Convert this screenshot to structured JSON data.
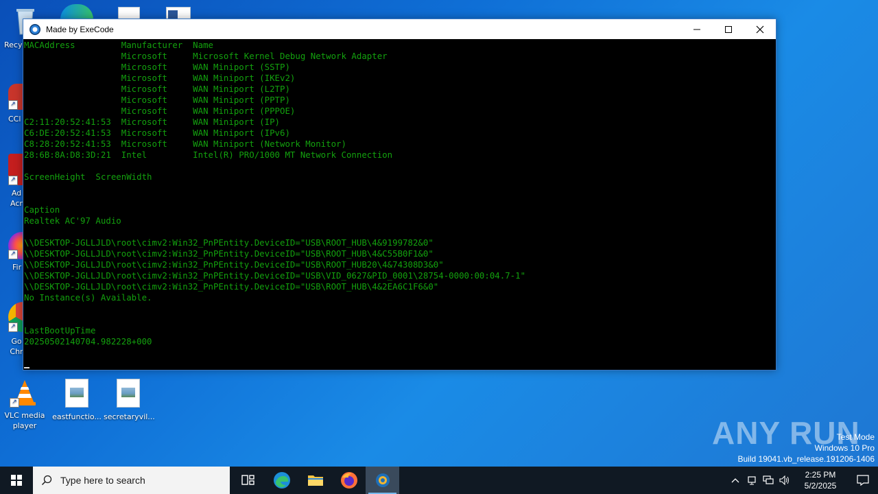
{
  "desktop": {
    "partial_icons": [
      {
        "label": "Recy"
      },
      {
        "label": "CCl"
      },
      {
        "label": "Ad Acr"
      },
      {
        "label": "Fir"
      },
      {
        "label": "Go Chr"
      }
    ],
    "icons": [
      {
        "label": "VLC media player"
      },
      {
        "label": "eastfunctio..."
      },
      {
        "label": "secretaryvil..."
      }
    ]
  },
  "window": {
    "title": "Made by ExeCode",
    "controls": {
      "minimize": "—",
      "maximize": "☐",
      "close": "✕"
    },
    "console_lines": [
      "MACAddress         Manufacturer  Name",
      "                   Microsoft     Microsoft Kernel Debug Network Adapter",
      "                   Microsoft     WAN Miniport (SSTP)",
      "                   Microsoft     WAN Miniport (IKEv2)",
      "                   Microsoft     WAN Miniport (L2TP)",
      "                   Microsoft     WAN Miniport (PPTP)",
      "                   Microsoft     WAN Miniport (PPPOE)",
      "C2:11:20:52:41:53  Microsoft     WAN Miniport (IP)",
      "C6:DE:20:52:41:53  Microsoft     WAN Miniport (IPv6)",
      "C8:28:20:52:41:53  Microsoft     WAN Miniport (Network Monitor)",
      "28:6B:8A:D8:3D:21  Intel         Intel(R) PRO/1000 MT Network Connection",
      "",
      "ScreenHeight  ScreenWidth",
      "",
      "",
      "Caption",
      "Realtek AC'97 Audio",
      "",
      "\\\\DESKTOP-JGLLJLD\\root\\cimv2:Win32_PnPEntity.DeviceID=\"USB\\ROOT_HUB\\4&9199782&0\"",
      "\\\\DESKTOP-JGLLJLD\\root\\cimv2:Win32_PnPEntity.DeviceID=\"USB\\ROOT_HUB\\4&C55B0F1&0\"",
      "\\\\DESKTOP-JGLLJLD\\root\\cimv2:Win32_PnPEntity.DeviceID=\"USB\\ROOT_HUB20\\4&74308D3&0\"",
      "\\\\DESKTOP-JGLLJLD\\root\\cimv2:Win32_PnPEntity.DeviceID=\"USB\\VID_0627&PID_0001\\28754-0000:00:04.7-1\"",
      "\\\\DESKTOP-JGLLJLD\\root\\cimv2:Win32_PnPEntity.DeviceID=\"USB\\ROOT_HUB\\4&2EA6C1F6&0\"",
      "No Instance(s) Available.",
      "",
      "",
      "LastBootUpTime",
      "20250502140704.982228+000"
    ],
    "text_color": "#13a10e"
  },
  "watermark": {
    "text": "ANY RUN"
  },
  "system_info": {
    "line1": "Test Mode",
    "line2": "Windows 10 Pro",
    "line3": "Build 19041.vb_release.191206-1406"
  },
  "taskbar": {
    "search_placeholder": "Type here to search",
    "apps": [
      {
        "name": "task-view"
      },
      {
        "name": "edge"
      },
      {
        "name": "file-explorer"
      },
      {
        "name": "firefox"
      },
      {
        "name": "execode-console",
        "active": true
      }
    ],
    "clock": {
      "time": "2:25 PM",
      "date": "5/2/2025"
    }
  }
}
